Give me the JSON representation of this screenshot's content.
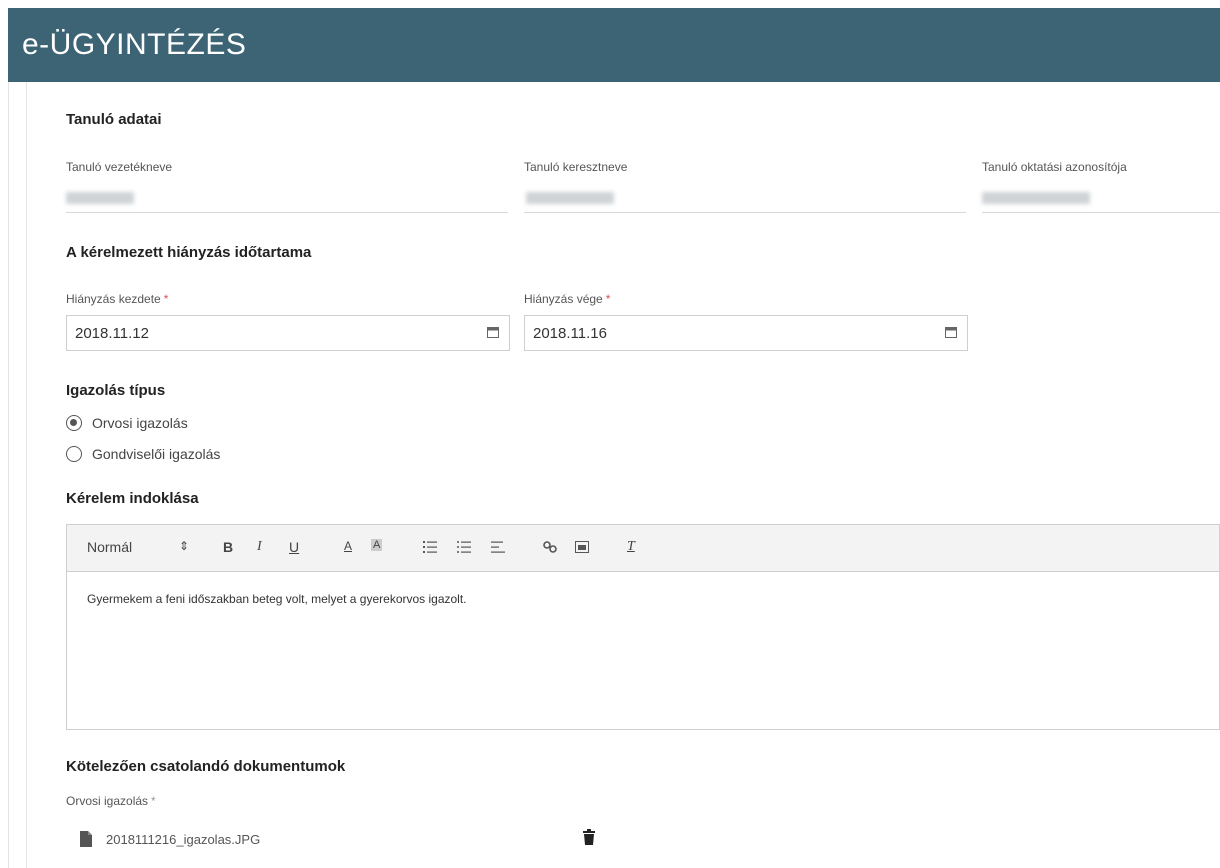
{
  "app": {
    "title": "e-ÜGYINTÉZÉS"
  },
  "student": {
    "section_title": "Tanuló adatai",
    "last_name_label": "Tanuló vezetékneve",
    "first_name_label": "Tanuló keresztneve",
    "id_label": "Tanuló oktatási azonosítója"
  },
  "absence": {
    "section_title": "A kérelmezett hiányzás időtartama",
    "start_label": "Hiányzás kezdete",
    "start_value": "2018.11.12",
    "end_label": "Hiányzás vége",
    "end_value": "2018.11.16",
    "required_mark": "*"
  },
  "justification": {
    "section_title": "Igazolás típus",
    "options": [
      {
        "label": "Orvosi igazolás",
        "selected": true
      },
      {
        "label": "Gondviselői igazolás",
        "selected": false
      }
    ]
  },
  "reason": {
    "section_title": "Kérelem indoklása",
    "toolbar": {
      "format_label": "Normál",
      "format_arrows": "⇕",
      "bold": "B",
      "italic": "I",
      "underline": "U",
      "text_color": "A",
      "bg_color": "A",
      "clear": "T"
    },
    "text": "Gyermekem a feni időszakban beteg volt, melyet a gyerekorvos igazolt."
  },
  "documents": {
    "section_title": "Kötelezően csatolandó dokumentumok",
    "field_label": "Orvosi igazolás",
    "required_mark": "*",
    "file_name": "2018111216_igazolas.JPG"
  }
}
